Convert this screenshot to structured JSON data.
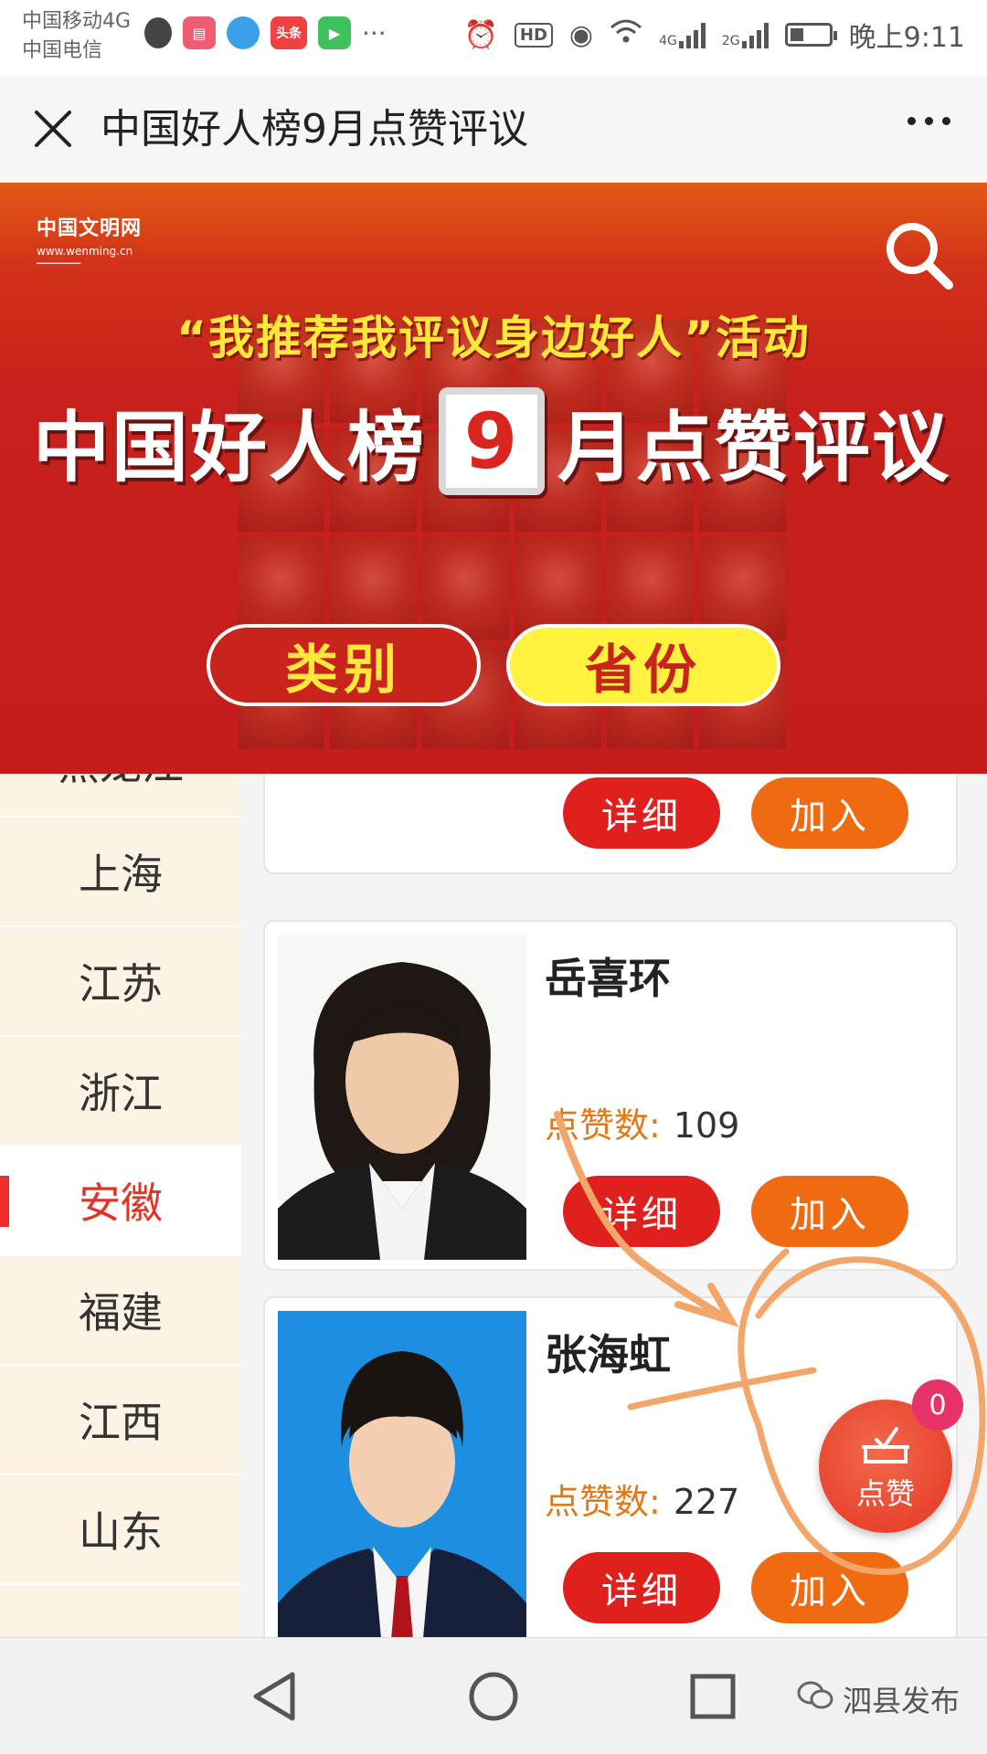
{
  "status_bar": {
    "carrier_1": "中国移动4G",
    "carrier_2": "中国电信",
    "network_1": "4G",
    "network_2": "2G",
    "hd": "HD",
    "time": "晚上9:11",
    "app_icons": [
      "qq-icon",
      "reader-icon",
      "mobile-icon",
      "toutiao-icon",
      "video-icon"
    ],
    "toutiao_label": "头条",
    "more": "···"
  },
  "title_bar": {
    "title": "中国好人榜9月点赞评议"
  },
  "banner": {
    "logo_main": "中国文明网",
    "logo_url": "www.wenming.cn",
    "slogan": "“我推荐我评议身边好人”活动",
    "headline_left": "中国好人榜",
    "month": "9",
    "headline_right": "月点赞评议",
    "button_category": "类别",
    "button_province": "省份"
  },
  "sidebar": {
    "items": [
      {
        "label": "黑龙江",
        "active": false
      },
      {
        "label": "上海",
        "active": false
      },
      {
        "label": "江苏",
        "active": false
      },
      {
        "label": "浙江",
        "active": false
      },
      {
        "label": "安徽",
        "active": true
      },
      {
        "label": "福建",
        "active": false
      },
      {
        "label": "江西",
        "active": false
      },
      {
        "label": "山东",
        "active": false
      }
    ]
  },
  "cards": {
    "partial": {
      "detail_label": "详细",
      "join_label": "加入"
    },
    "items": [
      {
        "name": "岳喜环",
        "votes_label": "点赞数:",
        "votes": "109",
        "detail_label": "详细",
        "join_label": "加入"
      },
      {
        "name": "张海虹",
        "votes_label": "点赞数:",
        "votes": "227",
        "detail_label": "详细",
        "join_label": "加入"
      }
    ]
  },
  "float_button": {
    "label": "点赞",
    "badge": "0"
  },
  "watermark": "泗县发布",
  "colors": {
    "banner_red": "#c41d1c",
    "accent_yellow": "#ffe83a",
    "detail_red": "#e0201c",
    "join_orange": "#f06a12",
    "votes_orange": "#e07a18",
    "active_red": "#e43225",
    "annotation_orange": "#f2a66a"
  }
}
